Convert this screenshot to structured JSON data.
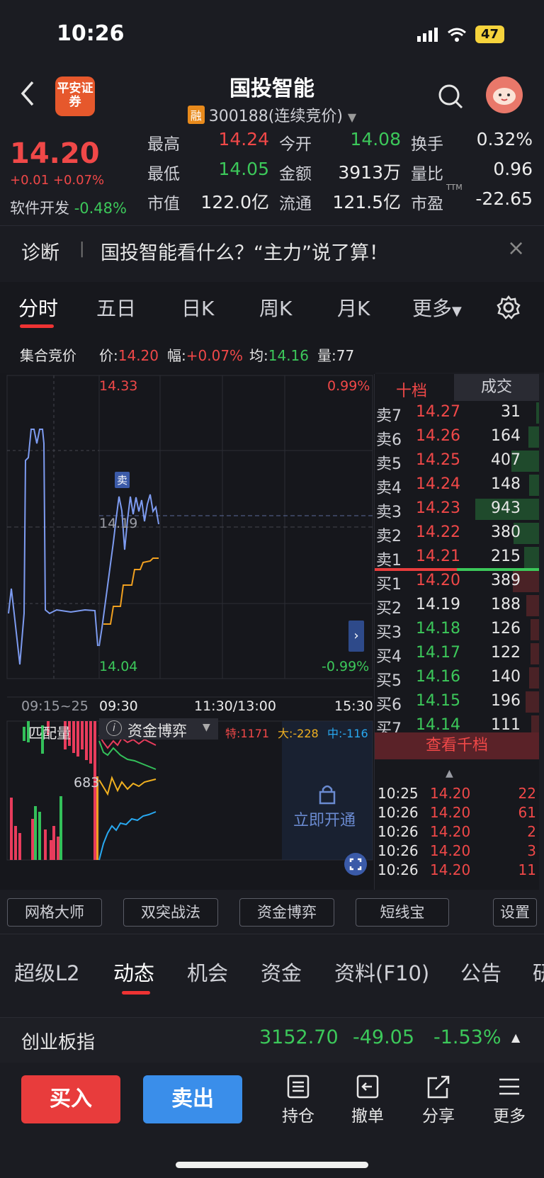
{
  "status_bar": {
    "time": "10:26",
    "battery": "47"
  },
  "header": {
    "broker_logo": "平安证券",
    "stock_name": "国投智能",
    "margin_badge": "融",
    "stock_code": "300188(连续竞价)"
  },
  "quote": {
    "price": "14.20",
    "change": "+0.01 +0.07%",
    "sector_name": "软件开发",
    "sector_change": "-0.48%",
    "rows": [
      [
        {
          "label": "最高",
          "value": "14.24",
          "color": "red"
        },
        {
          "label": "今开",
          "value": "14.08",
          "color": "green"
        },
        {
          "label": "换手",
          "value": "0.32%",
          "color": "white"
        }
      ],
      [
        {
          "label": "最低",
          "value": "14.05",
          "color": "green"
        },
        {
          "label": "金额",
          "value": "3913万",
          "color": "white"
        },
        {
          "label": "量比",
          "value": "0.96",
          "color": "white"
        }
      ],
      [
        {
          "label": "市值",
          "value": "122.0亿",
          "color": "white"
        },
        {
          "label": "流通",
          "value": "121.5亿",
          "color": "white"
        },
        {
          "label": "市盈",
          "value": "-22.65",
          "color": "white"
        }
      ]
    ],
    "pe_sup": "TTM"
  },
  "diagnose": {
    "label": "诊断",
    "separator": "|",
    "text": "国投智能看什么？“主力”说了算！",
    "close": "×"
  },
  "chart_tabs": [
    "分时",
    "五日",
    "日K",
    "周K",
    "月K",
    "更多"
  ],
  "info_line": {
    "mode": "集合竞价",
    "price_label": "价:",
    "price": "14.20",
    "range_label": "幅:",
    "range": "+0.07%",
    "avg_label": "均:",
    "avg": "14.16",
    "vol_label": "量:",
    "vol": "77"
  },
  "chart": {
    "y_top": "14.33",
    "y_mid": "14.19",
    "y_bottom": "14.04",
    "pct_top": "0.99%",
    "pct_bottom": "-0.99%",
    "sell_marker": "卖",
    "x_labels": [
      "09:15~25",
      "09:30",
      "11:30/13:00",
      "15:30"
    ],
    "sub_tab_left": "匹配量",
    "sub_tab_mid": "资金博弈",
    "sub_stats": [
      {
        "text": "特:1171",
        "color": "red"
      },
      {
        "text": "大:-228",
        "color": "yellow"
      },
      {
        "text": "中:-116",
        "color": "blue"
      }
    ],
    "sub_value": "683",
    "unlock_text": "立即开通"
  },
  "orderbook": {
    "tabs": [
      "十档",
      "成交"
    ],
    "asks": [
      {
        "label": "卖7",
        "price": "14.27",
        "vol": "31",
        "bar": 0.03
      },
      {
        "label": "卖6",
        "price": "14.26",
        "vol": "164",
        "bar": 0.17
      },
      {
        "label": "卖5",
        "price": "14.25",
        "vol": "407",
        "bar": 0.43
      },
      {
        "label": "卖4",
        "price": "14.24",
        "vol": "148",
        "bar": 0.16
      },
      {
        "label": "卖3",
        "price": "14.23",
        "vol": "943",
        "bar": 1.0
      },
      {
        "label": "卖2",
        "price": "14.22",
        "vol": "380",
        "bar": 0.4
      },
      {
        "label": "卖1",
        "price": "14.21",
        "vol": "215",
        "bar": 0.23
      }
    ],
    "bids": [
      {
        "label": "买1",
        "price": "14.20",
        "vol": "389",
        "bar": 0.41
      },
      {
        "label": "买2",
        "price": "14.19",
        "vol": "188",
        "bar": 0.2
      },
      {
        "label": "买3",
        "price": "14.18",
        "vol": "126",
        "bar": 0.13
      },
      {
        "label": "买4",
        "price": "14.17",
        "vol": "122",
        "bar": 0.13
      },
      {
        "label": "买5",
        "price": "14.16",
        "vol": "140",
        "bar": 0.15
      },
      {
        "label": "买6",
        "price": "14.15",
        "vol": "196",
        "bar": 0.21
      },
      {
        "label": "买7",
        "price": "14.14",
        "vol": "111",
        "bar": 0.12
      }
    ],
    "view_more": "查看千档",
    "trades": [
      {
        "time": "10:25",
        "price": "14.20",
        "vol": "22"
      },
      {
        "time": "10:26",
        "price": "14.20",
        "vol": "61"
      },
      {
        "time": "10:26",
        "price": "14.20",
        "vol": "2"
      },
      {
        "time": "10:26",
        "price": "14.20",
        "vol": "3"
      },
      {
        "time": "10:26",
        "price": "14.20",
        "vol": "11"
      }
    ]
  },
  "tools": [
    "网格大师",
    "双突战法",
    "资金博弈",
    "短线宝",
    "设置"
  ],
  "bottom_tabs": [
    "超级L2",
    "动态",
    "机会",
    "资金",
    "资料(F10)",
    "公告",
    "研"
  ],
  "index_bar": {
    "name": "创业板指",
    "value": "3152.70",
    "change": "-49.05",
    "pct": "-1.53%"
  },
  "actions": {
    "buy": "买入",
    "sell": "卖出",
    "items": [
      "持仓",
      "撤单",
      "分享",
      "更多"
    ]
  }
}
